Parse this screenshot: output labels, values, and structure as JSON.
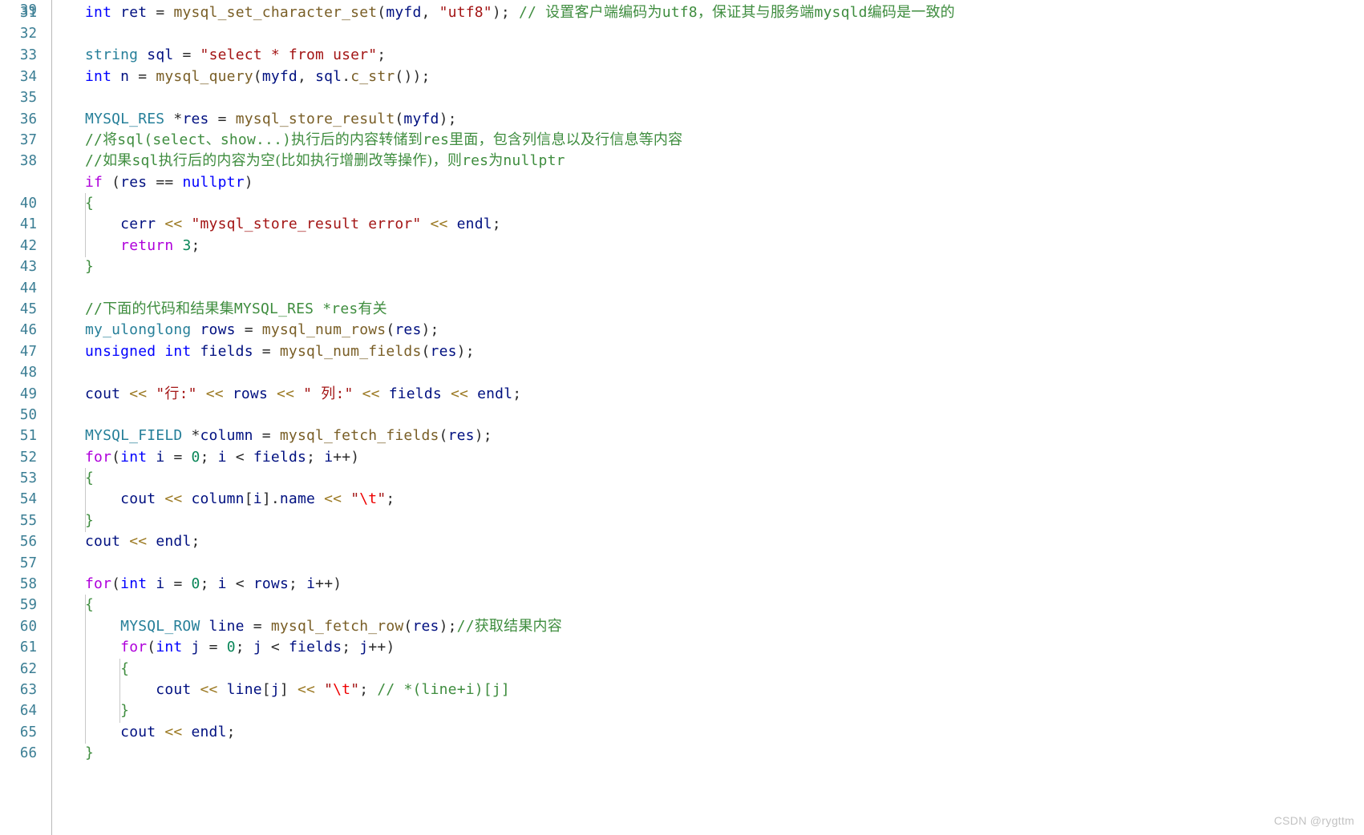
{
  "editor": {
    "language": "cpp",
    "first_line_number": 31,
    "last_line_number": 66,
    "background_color": "#ffffff",
    "gutter_color": "#3b7e94",
    "watermark": "CSDN @rygttm"
  },
  "palette": {
    "keyword": "#0000ff",
    "control": "#af00db",
    "type": "#267f99",
    "function": "#795e26",
    "string": "#a31515",
    "escape": "#ee0000",
    "comment": "#3f8d3f",
    "number": "#098658",
    "variable": "#001080",
    "operator": "#9c7a24",
    "plain": "#2b2b2b",
    "gutter": "#3b7e94",
    "guide": "#c8c8c8",
    "divider": "#b9b9b9",
    "watermark": "#c2c2c2"
  },
  "line_numbers": [
    "31",
    "32",
    "33",
    "34",
    "35",
    "36",
    "37",
    "38",
    "39",
    "40",
    "41",
    "42",
    "43",
    "44",
    "45",
    "46",
    "47",
    "48",
    "49",
    "50",
    "51",
    "52",
    "53",
    "54",
    "55",
    "56",
    "57",
    "58",
    "59",
    "60",
    "61",
    "62",
    "63",
    "64",
    "65",
    "66"
  ],
  "lines": [
    {
      "n": "31",
      "text": "int ret = mysql_set_character_set(myfd, \"utf8\"); // 设置客户端编码为utf8，保证其与服务端mysqld编码是一致的"
    },
    {
      "n": "32",
      "text": ""
    },
    {
      "n": "33",
      "text": "string sql = \"select * from user\";"
    },
    {
      "n": "34",
      "text": "int n = mysql_query(myfd, sql.c_str());"
    },
    {
      "n": "35",
      "text": ""
    },
    {
      "n": "36",
      "text": "MYSQL_RES *res = mysql_store_result(myfd);"
    },
    {
      "n": "37",
      "text": "//将sql(select、show...)执行后的内容转储到res里面，包含列信息以及行信息等内容"
    },
    {
      "n": "38",
      "text": "//如果sql执行后的内容为空(比如执行增删改等操作)，则res为nullptr"
    },
    {
      "n": "39",
      "text": "if (res == nullptr)"
    },
    {
      "n": "40",
      "text": "{"
    },
    {
      "n": "41",
      "text": "    cerr << \"mysql_store_result error\" << endl;"
    },
    {
      "n": "42",
      "text": "    return 3;"
    },
    {
      "n": "43",
      "text": "}"
    },
    {
      "n": "44",
      "text": ""
    },
    {
      "n": "45",
      "text": "//下面的代码和结果集MYSQL_RES *res有关"
    },
    {
      "n": "46",
      "text": "my_ulonglong rows = mysql_num_rows(res);"
    },
    {
      "n": "47",
      "text": "unsigned int fields = mysql_num_fields(res);"
    },
    {
      "n": "48",
      "text": ""
    },
    {
      "n": "49",
      "text": "cout << \"行:\" << rows << \" 列:\" << fields << endl;"
    },
    {
      "n": "50",
      "text": ""
    },
    {
      "n": "51",
      "text": "MYSQL_FIELD *column = mysql_fetch_fields(res);"
    },
    {
      "n": "52",
      "text": "for(int i = 0; i < fields; i++)"
    },
    {
      "n": "53",
      "text": "{"
    },
    {
      "n": "54",
      "text": "    cout << column[i].name << \"\\t\";"
    },
    {
      "n": "55",
      "text": "}"
    },
    {
      "n": "56",
      "text": "cout << endl;"
    },
    {
      "n": "57",
      "text": ""
    },
    {
      "n": "58",
      "text": "for(int i = 0; i < rows; i++)"
    },
    {
      "n": "59",
      "text": "{"
    },
    {
      "n": "60",
      "text": "    MYSQL_ROW line = mysql_fetch_row(res);//获取结果内容"
    },
    {
      "n": "61",
      "text": "    for(int j = 0; j < fields; j++)"
    },
    {
      "n": "62",
      "text": "    {"
    },
    {
      "n": "63",
      "text": "        cout << line[j] << \"\\t\"; // *(line+i)[j]"
    },
    {
      "n": "64",
      "text": "    }"
    },
    {
      "n": "65",
      "text": "    cout << endl;"
    },
    {
      "n": "66",
      "text": "}"
    }
  ]
}
